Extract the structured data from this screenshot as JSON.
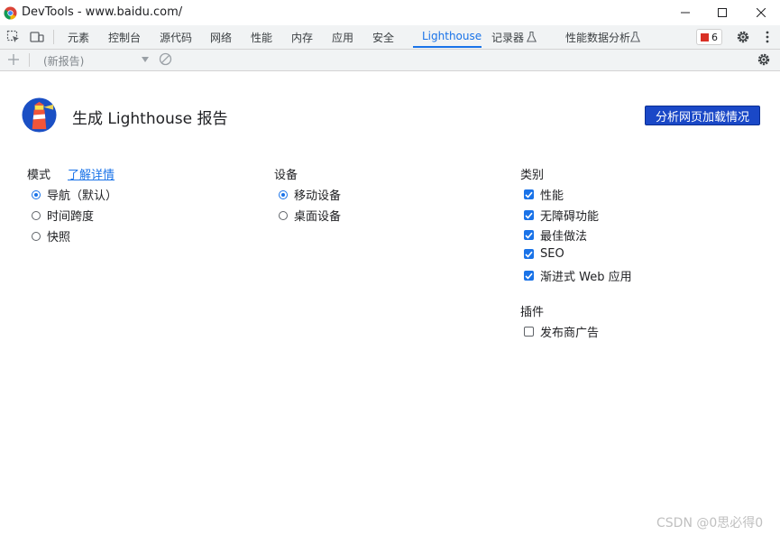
{
  "window": {
    "title": "DevTools - www.baidu.com/"
  },
  "tabs": [
    {
      "label": "元素"
    },
    {
      "label": "控制台"
    },
    {
      "label": "源代码"
    },
    {
      "label": "网络"
    },
    {
      "label": "性能"
    },
    {
      "label": "内存"
    },
    {
      "label": "应用"
    },
    {
      "label": "安全"
    },
    {
      "label": "Lighthouse",
      "active": true
    },
    {
      "label": "记录器"
    },
    {
      "label": "性能数据分析"
    }
  ],
  "issues": {
    "count": "6"
  },
  "toolbar": {
    "report_select": "(新报告)"
  },
  "header": {
    "title": "生成 Lighthouse 报告",
    "analyze_button": "分析网页加载情况"
  },
  "mode": {
    "label": "模式",
    "learn_more": "了解详情",
    "options": [
      {
        "label": "导航（默认）",
        "checked": true
      },
      {
        "label": "时间跨度",
        "checked": false
      },
      {
        "label": "快照",
        "checked": false
      }
    ]
  },
  "device": {
    "label": "设备",
    "options": [
      {
        "label": "移动设备",
        "checked": true
      },
      {
        "label": "桌面设备",
        "checked": false
      }
    ]
  },
  "categories": {
    "label": "类别",
    "items": [
      {
        "label": "性能",
        "checked": true
      },
      {
        "label": "无障碍功能",
        "checked": true
      },
      {
        "label": "最佳做法",
        "checked": true
      },
      {
        "label": "SEO",
        "checked": true
      },
      {
        "label": "渐进式 Web 应用",
        "checked": true
      }
    ]
  },
  "plugins": {
    "label": "插件",
    "items": [
      {
        "label": "发布商广告",
        "checked": false
      }
    ]
  },
  "watermark": "CSDN @0思必得0",
  "colors": {
    "accent": "#1a73e8",
    "primary_button": "#1a48c7"
  }
}
